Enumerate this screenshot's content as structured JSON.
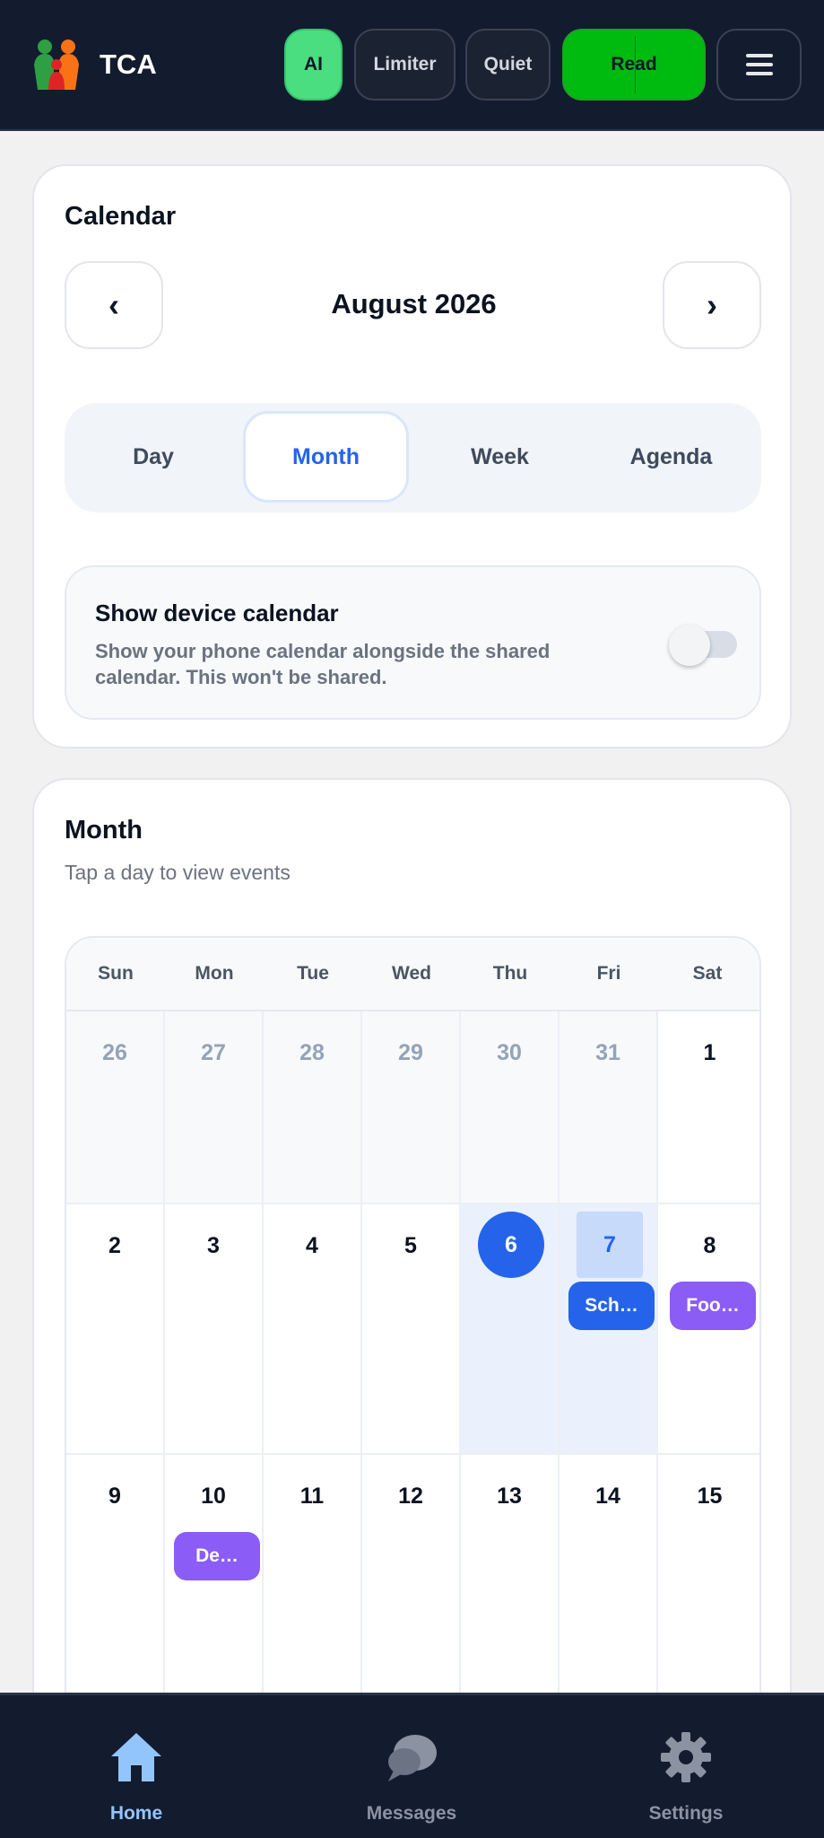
{
  "header": {
    "app_name": "TCA",
    "buttons": {
      "ai": "AI",
      "limiter": "Limiter",
      "quiet": "Quiet",
      "read": "Read"
    },
    "menu_icon": "hamburger-menu-icon"
  },
  "calendar_card": {
    "title": "Calendar",
    "prev_glyph": "‹",
    "next_glyph": "›",
    "current_month": "August 2026",
    "view_tabs": [
      "Day",
      "Month",
      "Week",
      "Agenda"
    ],
    "selected_view": "Month",
    "device_calendar": {
      "title": "Show device calendar",
      "description": "Show your phone calendar alongside the shared calendar. This won't be shared.",
      "enabled": false
    }
  },
  "month_card": {
    "title": "Month",
    "subtitle": "Tap a day to view events",
    "weekdays": [
      "Sun",
      "Mon",
      "Tue",
      "Wed",
      "Thu",
      "Fri",
      "Sat"
    ],
    "weeks": [
      [
        {
          "day": "26",
          "muted": true
        },
        {
          "day": "27",
          "muted": true
        },
        {
          "day": "28",
          "muted": true
        },
        {
          "day": "29",
          "muted": true
        },
        {
          "day": "30",
          "muted": true
        },
        {
          "day": "31",
          "muted": true
        },
        {
          "day": "1"
        }
      ],
      [
        {
          "day": "2"
        },
        {
          "day": "3"
        },
        {
          "day": "4"
        },
        {
          "day": "5"
        },
        {
          "day": "6",
          "today": true
        },
        {
          "day": "7",
          "selected": true,
          "event": {
            "label": "Sch…",
            "color": "#2563eb"
          }
        },
        {
          "day": "8",
          "event": {
            "label": "Foo…",
            "color": "#8b5cf6"
          }
        }
      ],
      [
        {
          "day": "9"
        },
        {
          "day": "10",
          "event": {
            "label": "De…",
            "color": "#8b5cf6"
          }
        },
        {
          "day": "11"
        },
        {
          "day": "12"
        },
        {
          "day": "13"
        },
        {
          "day": "14"
        },
        {
          "day": "15"
        }
      ]
    ]
  },
  "bottom_nav": {
    "items": [
      {
        "label": "Home",
        "icon": "home-icon",
        "active": true
      },
      {
        "label": "Messages",
        "icon": "chat-bubbles-icon",
        "active": false
      },
      {
        "label": "Settings",
        "icon": "gear-icon",
        "active": false
      }
    ]
  },
  "colors": {
    "header_bg": "#131b2e",
    "accent_blue": "#2563eb",
    "ai_green": "#4ade80",
    "read_green": "#00bb0f",
    "event_purple": "#8b5cf6"
  }
}
